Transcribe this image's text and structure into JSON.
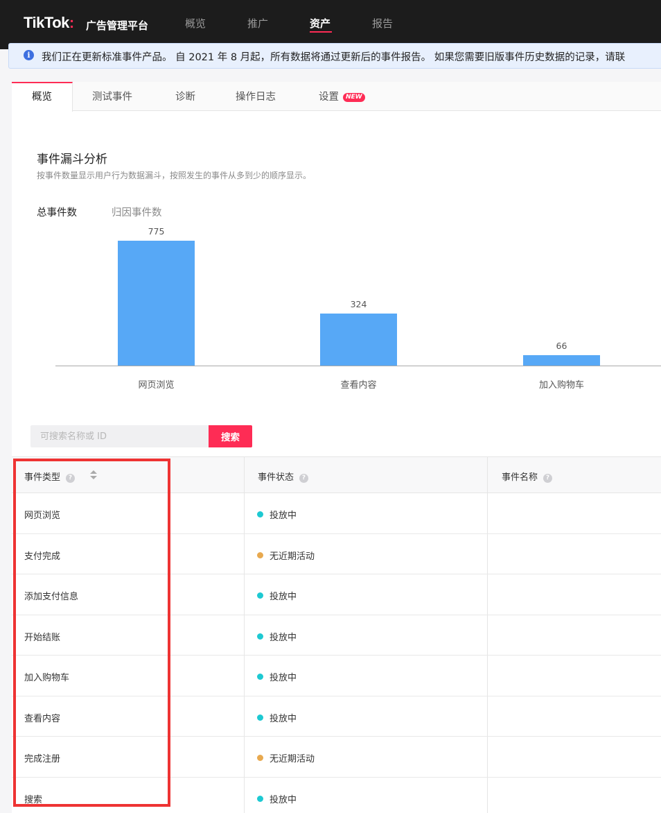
{
  "app": {
    "logo_text": "TikTok",
    "logo_colon": ":",
    "logo_sub": "广告管理平台"
  },
  "nav": [
    "概览",
    "推广",
    "资产",
    "报告"
  ],
  "nav_active": "资产",
  "notice": {
    "text": "我们正在更新标准事件产品。 自 2021 年 8 月起，所有数据将通过更新后的事件报告。 如果您需要旧版事件历史数据的记录，请联"
  },
  "tabs": [
    "概览",
    "测试事件",
    "诊断",
    "操作日志",
    "设置"
  ],
  "tab_badge": "NEW",
  "section": {
    "title": "事件漏斗分析",
    "subtitle": "按事件数量显示用户行为数据漏斗，按照发生的事件从多到少的顺序显示。",
    "metric_tabs": [
      "总事件数",
      "归因事件数"
    ]
  },
  "chart_data": {
    "type": "bar",
    "categories": [
      "网页浏览",
      "查看内容",
      "加入购物车"
    ],
    "values": [
      775,
      324,
      66
    ],
    "ylim": [
      0,
      775
    ],
    "color": "#57a8f6",
    "grid": false
  },
  "search": {
    "placeholder": "可搜索名称或 ID",
    "button": "搜索"
  },
  "table": {
    "headers": [
      "事件类型",
      "事件状态",
      "事件名称"
    ],
    "rows": [
      {
        "type": "网页浏览",
        "status": "投放中",
        "status_color": "#1dc9d2"
      },
      {
        "type": "支付完成",
        "status": "无近期活动",
        "status_color": "#e8a94f"
      },
      {
        "type": "添加支付信息",
        "status": "投放中",
        "status_color": "#1dc9d2"
      },
      {
        "type": "开始结账",
        "status": "投放中",
        "status_color": "#1dc9d2"
      },
      {
        "type": "加入购物车",
        "status": "投放中",
        "status_color": "#1dc9d2"
      },
      {
        "type": "查看内容",
        "status": "投放中",
        "status_color": "#1dc9d2"
      },
      {
        "type": "完成注册",
        "status": "无近期活动",
        "status_color": "#e8a94f"
      },
      {
        "type": "搜索",
        "status": "投放中",
        "status_color": "#1dc9d2"
      }
    ]
  },
  "colors": {
    "brand": "#fe2c55",
    "topbar": "#1c1c1c",
    "highlight": "#ee3333"
  }
}
